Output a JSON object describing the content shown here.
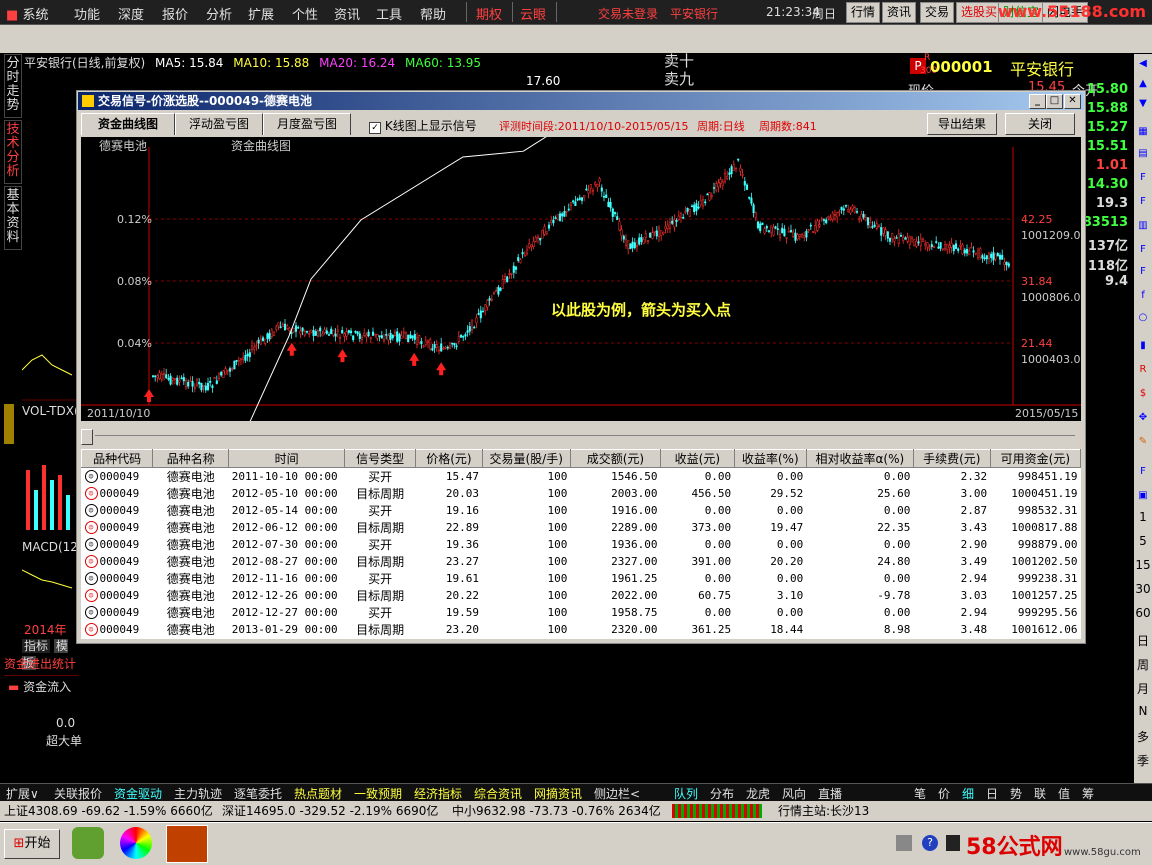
{
  "menu": {
    "items": [
      "系统",
      "功能",
      "深度",
      "报价",
      "分析",
      "扩展",
      "个性",
      "资讯",
      "工具",
      "帮助"
    ],
    "extra": [
      "期权",
      "云眼"
    ],
    "status": [
      "交易未登录",
      "平安银行"
    ],
    "clock": "21:23:34",
    "weekday": "周日",
    "buttons": [
      "行情",
      "资讯",
      "交易"
    ],
    "promo1": "选股买",
    "promo2": "财信宝",
    "promo3": "闪电手",
    "site": "www.55188.com"
  },
  "left_tabs": [
    "分时走势",
    "技术分析",
    "基本资料"
  ],
  "stock_header": {
    "title": "平安银行(日线,前复权)",
    "ma5": "MA5: 15.84",
    "ma10": "MA10: 15.88",
    "ma20": "MA20: 16.24",
    "ma60": "MA60: 13.95",
    "price_label": "17.60"
  },
  "order_book": [
    "卖十",
    "卖九"
  ],
  "right_panel": {
    "code": "000001",
    "name": "平安银行",
    "logo": "P",
    "sub1": "R",
    "sub2": "300",
    "row_label": "现价",
    "row_value": "15.45",
    "row_label2": "今开",
    "values": [
      "15.80",
      "15.88",
      "15.27",
      "15.51",
      "1.01",
      "14.30",
      "19.3",
      "383513",
      "137亿",
      "118亿",
      "9.4"
    ]
  },
  "lower_left": {
    "vol": "VOL-TDX(",
    "macd": "MACD(12",
    "year": "2014年",
    "tab1": "指标",
    "tab2": "模板",
    "flow": "资金进出统计",
    "flow_in": "资金流入",
    "zero": "0.0",
    "big": "超大单"
  },
  "dialog": {
    "title": "交易信号-价涨选股--000049-德赛电池",
    "tabs": [
      "资金曲线图",
      "浮动盈亏图",
      "月度盈亏图"
    ],
    "checkbox": "K线图上显示信号",
    "eval_period": "评测时间段:2011/10/10-2015/05/15",
    "cycle": "周期:日线",
    "cycle_count": "周期数:841",
    "export": "导出结果",
    "close": "关闭",
    "chart_stock": "德赛电池",
    "chart_curve": "资金曲线图",
    "annotation": "以此股为例，箭头为买入点",
    "date_start": "2011/10/10",
    "date_end": "2015/05/15"
  },
  "chart_data": {
    "type": "line",
    "title": "资金曲线图",
    "left_axis_ticks": [
      "0.12%",
      "0.08%",
      "0.04%"
    ],
    "right_price_ticks": [
      "42.25",
      "31.84",
      "21.44"
    ],
    "right_capital_ticks": [
      "1001209.05",
      "1000806.03",
      "1000403.02"
    ],
    "x_range": [
      "2011/10/10",
      "2015/05/15"
    ],
    "capital_curve": {
      "x": [
        "2011-10-10",
        "2012-05-10",
        "2012-06-12",
        "2012-08-27",
        "2013-01-29",
        "2013-05",
        "2013-08"
      ],
      "y": [
        998451.19,
        1000451.19,
        1000817.88,
        1001202.5,
        1001612.06,
        1001650,
        1001900
      ]
    },
    "buy_signals": [
      "2011-10-10",
      "2012-05-14",
      "2012-07-30",
      "2012-11-16",
      "2012-12-27"
    ]
  },
  "table": {
    "headers": [
      "品种代码",
      "品种名称",
      "时间",
      "信号类型",
      "价格(元)",
      "交易量(股/手)",
      "成交额(元)",
      "收益(元)",
      "收益率(%)",
      "相对收益率α(%)",
      "手续费(元)",
      "可用资金(元)"
    ],
    "rows": [
      [
        "000049",
        "德赛电池",
        "2011-10-10 00:00",
        "买开",
        "15.47",
        "100",
        "1546.50",
        "0.00",
        "0.00",
        "0.00",
        "2.32",
        "998451.19"
      ],
      [
        "000049",
        "德赛电池",
        "2012-05-10 00:00",
        "目标周期",
        "20.03",
        "100",
        "2003.00",
        "456.50",
        "29.52",
        "25.60",
        "3.00",
        "1000451.19"
      ],
      [
        "000049",
        "德赛电池",
        "2012-05-14 00:00",
        "买开",
        "19.16",
        "100",
        "1916.00",
        "0.00",
        "0.00",
        "0.00",
        "2.87",
        "998532.31"
      ],
      [
        "000049",
        "德赛电池",
        "2012-06-12 00:00",
        "目标周期",
        "22.89",
        "100",
        "2289.00",
        "373.00",
        "19.47",
        "22.35",
        "3.43",
        "1000817.88"
      ],
      [
        "000049",
        "德赛电池",
        "2012-07-30 00:00",
        "买开",
        "19.36",
        "100",
        "1936.00",
        "0.00",
        "0.00",
        "0.00",
        "2.90",
        "998879.00"
      ],
      [
        "000049",
        "德赛电池",
        "2012-08-27 00:00",
        "目标周期",
        "23.27",
        "100",
        "2327.00",
        "391.00",
        "20.20",
        "24.80",
        "3.49",
        "1001202.50"
      ],
      [
        "000049",
        "德赛电池",
        "2012-11-16 00:00",
        "买开",
        "19.61",
        "100",
        "1961.25",
        "0.00",
        "0.00",
        "0.00",
        "2.94",
        "999238.31"
      ],
      [
        "000049",
        "德赛电池",
        "2012-12-26 00:00",
        "目标周期",
        "20.22",
        "100",
        "2022.00",
        "60.75",
        "3.10",
        "-9.78",
        "3.03",
        "1001257.25"
      ],
      [
        "000049",
        "德赛电池",
        "2012-12-27 00:00",
        "买开",
        "19.59",
        "100",
        "1958.75",
        "0.00",
        "0.00",
        "0.00",
        "2.94",
        "999295.56"
      ],
      [
        "000049",
        "德赛电池",
        "2013-01-29 00:00",
        "目标周期",
        "23.20",
        "100",
        "2320.00",
        "361.25",
        "18.44",
        "8.98",
        "3.48",
        "1001612.06"
      ]
    ]
  },
  "bottom_tabs": [
    "扩展∨",
    "关联报价",
    "资金驱动",
    "主力轨迹",
    "逐笔委托",
    "热点题材",
    "一致预期",
    "经济指标",
    "综合资讯",
    "网摘资讯",
    "侧边栏<",
    "队列",
    "分布",
    "龙虎",
    "风向",
    "直播",
    "笔",
    "价",
    "细",
    "日",
    "势",
    "联",
    "值",
    "筹"
  ],
  "status": {
    "sh": "上证4308.69 -69.62 -1.59% 6660亿",
    "sz": "深证14695.0 -329.52 -2.19% 6690亿",
    "zx": "中小9632.98 -73.73 -0.76% 2634亿",
    "host": "行情主站:长沙13"
  },
  "taskbar": {
    "start": "开始",
    "brand": "58公式网",
    "url": "www.58gu.com"
  },
  "icon_labels": [
    "1",
    "5",
    "15",
    "30",
    "60",
    "日",
    "周",
    "月",
    "N",
    "多",
    "季"
  ],
  "colors": {
    "accent_red": "#ff4040",
    "yellow": "#ffff40",
    "green": "#40ff40"
  }
}
